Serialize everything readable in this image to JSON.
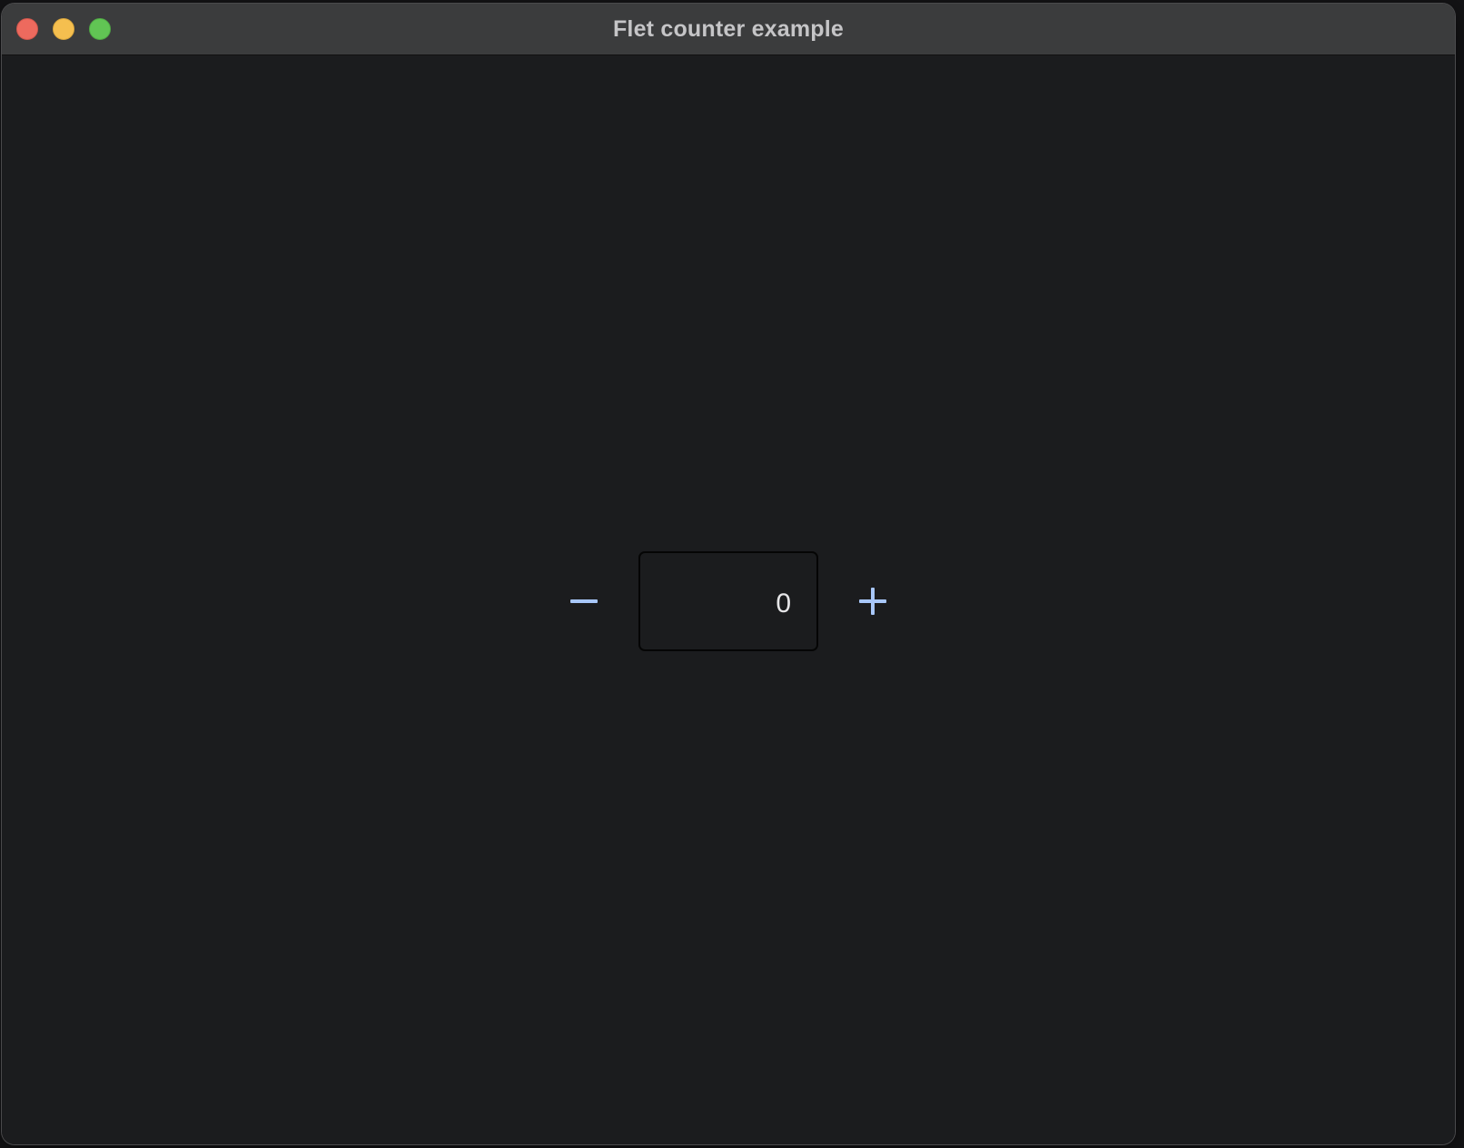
{
  "window": {
    "title": "Flet counter example"
  },
  "counter": {
    "value": "0",
    "decrement_icon": "remove-icon",
    "increment_icon": "add-icon"
  },
  "colors": {
    "accent": "#a8c7fa",
    "background": "#1b1c1e",
    "titlebar": "#3b3c3d",
    "close": "#ed6a5e",
    "minimize": "#f5bf4f",
    "maximize": "#61c554"
  }
}
